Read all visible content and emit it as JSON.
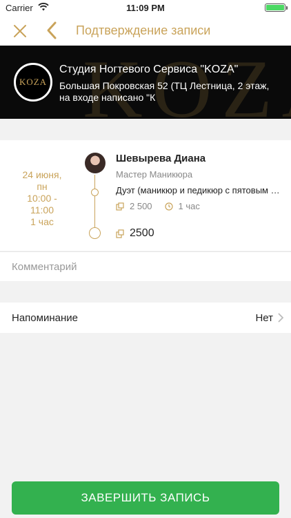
{
  "status_bar": {
    "carrier": "Carrier",
    "time": "11:09 PM"
  },
  "nav": {
    "title": "Подтверждение записи",
    "close_icon": "close-icon",
    "back_icon": "chevron-left-icon"
  },
  "salon": {
    "logo_text": "KOZA",
    "background_text": "KOZA",
    "name": "Студия Ногтевого Сервиса \"KOZA\"",
    "address": "Большая Покровская 52 (ТЦ Лестница, 2 этаж, на входе написано \"К"
  },
  "booking": {
    "date": "24 июня,",
    "weekday": "пн",
    "time_start": "10:00 -",
    "time_end": "11:00",
    "duration": "1 час",
    "master_name": "Шевырева Диана",
    "master_role": "Мастер Маникюра",
    "service": "Дуэт (маникюр и педикюр с пятовым покрытием)",
    "service_price": "2 500",
    "service_duration": "1 час",
    "total": "2500"
  },
  "comment": {
    "placeholder": "Комментарий",
    "value": ""
  },
  "reminder": {
    "label": "Напоминание",
    "value": "Нет"
  },
  "finish_button": "ЗАВЕРШИТЬ ЗАПИСЬ",
  "colors": {
    "accent": "#c9a35a",
    "button": "#33b14f"
  }
}
